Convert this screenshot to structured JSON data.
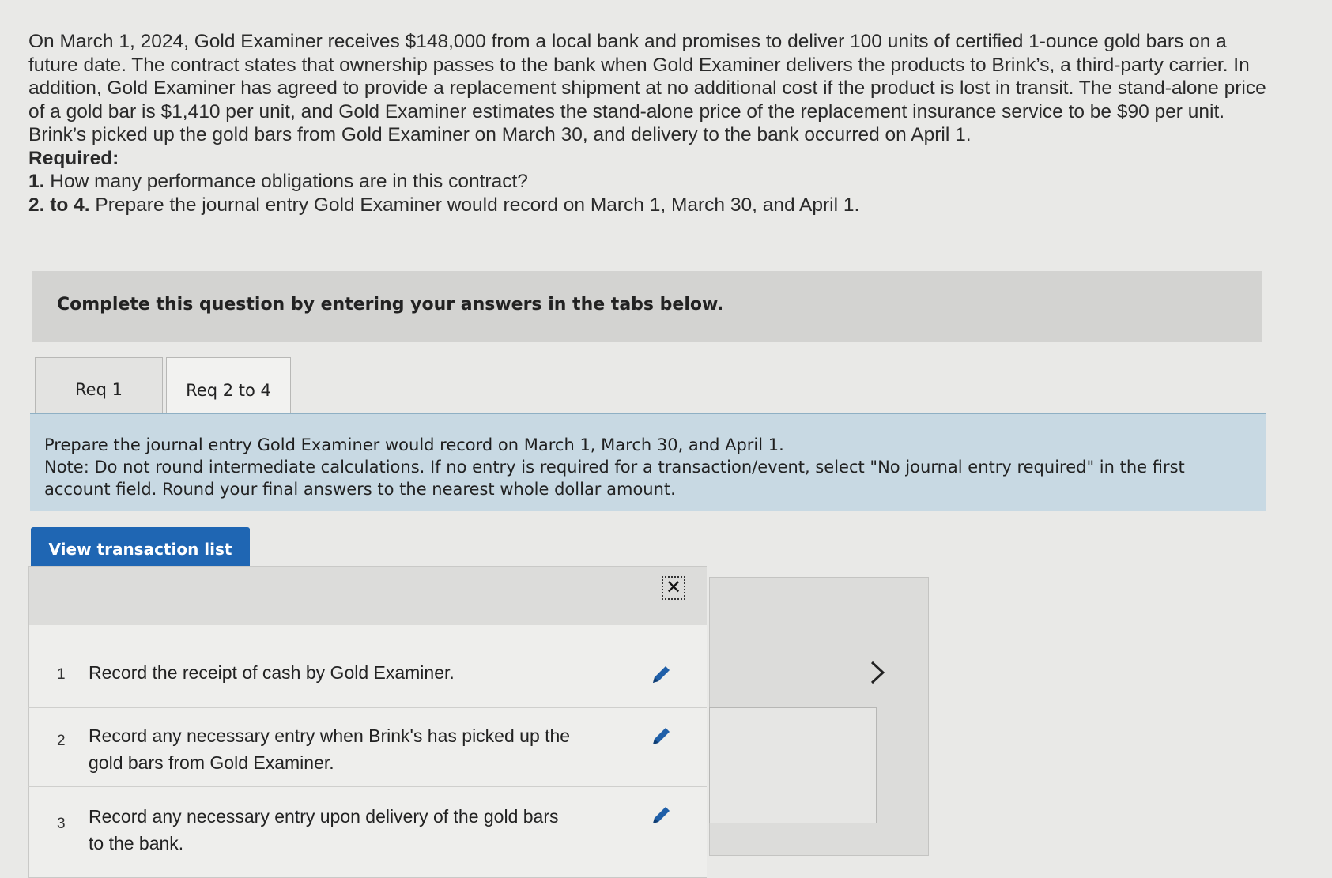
{
  "question": {
    "intro": "On March 1, 2024, Gold Examiner receives $148,000 from a local bank and promises to deliver 100 units of certified 1-ounce gold bars on a future date. The contract states that ownership passes to the bank when Gold Examiner delivers the products to Brink’s, a third-party carrier. In addition, Gold Examiner has agreed to provide a replacement shipment at no additional cost if the product is lost in transit. The stand-alone price of a gold bar is $1,410 per unit, and Gold Examiner estimates the stand-alone price of the replacement insurance service to be $90 per unit. Brink’s picked up the gold bars from Gold Examiner on March 30, and delivery to the bank occurred on April 1.",
    "required_label": "Required:",
    "req1_num": "1.",
    "req1_text": " How many performance obligations are in this contract?",
    "req2_num": "2. to 4.",
    "req2_text": " Prepare the journal entry Gold Examiner would record on March 1, March 30, and April 1."
  },
  "banner": "Complete this question by entering your answers in the tabs below.",
  "tabs": [
    {
      "label": "Req 1",
      "active": false
    },
    {
      "label": "Req 2 to 4",
      "active": true
    }
  ],
  "instructions": {
    "line1": "Prepare the journal entry Gold Examiner would record on March 1, March 30, and April 1.",
    "note": "Note: Do not round intermediate calculations. If no entry is required for a transaction/event, select \"No journal entry required\" in the first account field. Round your final answers to the nearest whole dollar amount."
  },
  "transaction_button": "View transaction list",
  "close_glyph": "✕",
  "transactions": [
    {
      "num": "1",
      "text": "Record the receipt of cash by Gold Examiner."
    },
    {
      "num": "2",
      "text": "Record any necessary entry when Brink's has picked up the gold bars from Gold Examiner."
    },
    {
      "num": "3",
      "text": "Record any necessary entry upon delivery of the gold bars to the bank."
    }
  ],
  "colors": {
    "primary_button": "#1f66b3",
    "pencil": "#1f5fa8",
    "instruction_bg": "#c8d9e3"
  }
}
